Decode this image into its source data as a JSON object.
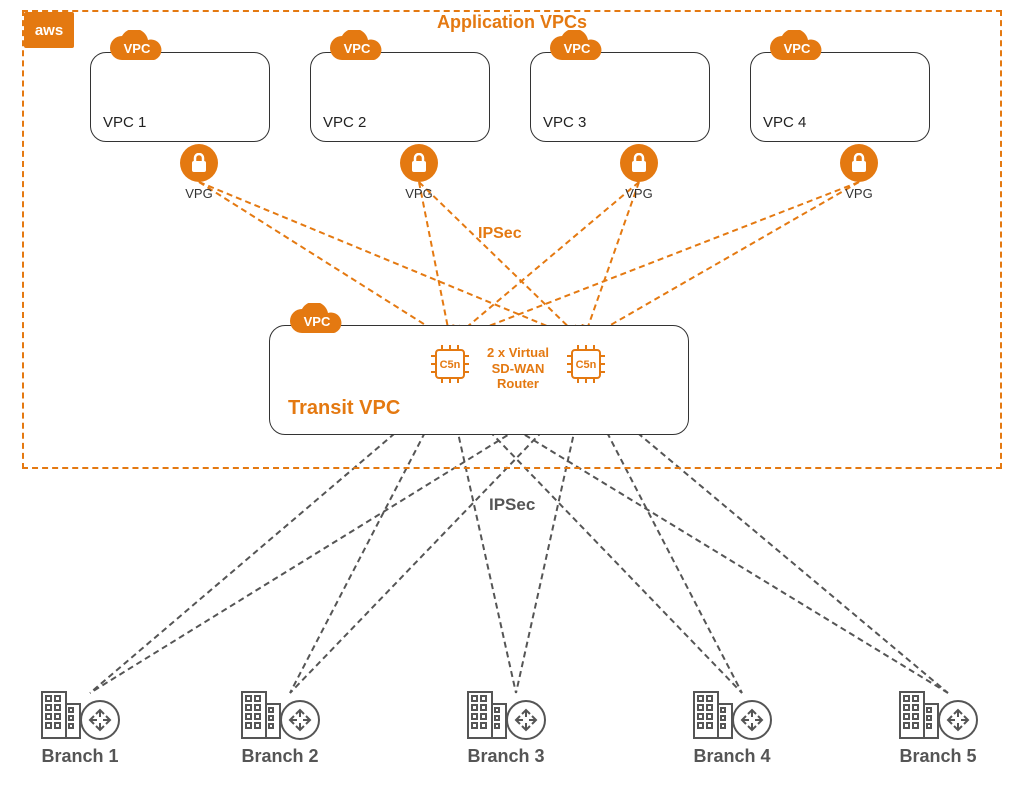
{
  "aws_logo": "aws",
  "section_title": "Application VPCs",
  "vpcs": [
    {
      "name": "VPC 1",
      "gateway": "VPG",
      "badge": "VPC"
    },
    {
      "name": "VPC 2",
      "gateway": "VPG",
      "badge": "VPC"
    },
    {
      "name": "VPC 3",
      "gateway": "VPG",
      "badge": "VPC"
    },
    {
      "name": "VPC 4",
      "gateway": "VPG",
      "badge": "VPC"
    }
  ],
  "ipsec_upper": "IPSec",
  "transit": {
    "label": "Transit VPC",
    "badge": "VPC",
    "chip1": "C5n",
    "chip2": "C5n",
    "router_caption_l1": "2 x Virtual",
    "router_caption_l2": "SD-WAN",
    "router_caption_l3": "Router"
  },
  "ipsec_lower": "IPSec",
  "branches": [
    {
      "name": "Branch 1"
    },
    {
      "name": "Branch 2"
    },
    {
      "name": "Branch 3"
    },
    {
      "name": "Branch 4"
    },
    {
      "name": "Branch 5"
    }
  ],
  "colors": {
    "accent": "#e47911",
    "gray": "#555555"
  }
}
